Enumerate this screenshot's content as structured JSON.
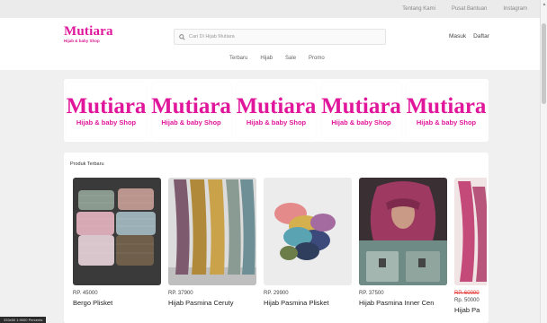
{
  "top_links": [
    "Tentang Kami",
    "Pusat Bantuan",
    "Instagram"
  ],
  "logo": {
    "main": "Mutiara",
    "sub": "Hijab & baby Shop"
  },
  "search": {
    "placeholder": "Cari Di Hijab Mutiara"
  },
  "auth": {
    "login": "Masuk",
    "register": "Daftar"
  },
  "nav": [
    "Terbaru",
    "Hijab",
    "Sale",
    "Promo"
  ],
  "banners": [
    {
      "title": "Mutiara",
      "sub": "Hijab & baby Shop"
    },
    {
      "title": "Mutiara",
      "sub": "Hijab & baby Shop"
    },
    {
      "title": "Mutiara",
      "sub": "Hijab & baby Shop"
    },
    {
      "title": "Mutiara",
      "sub": "Hijab & baby Shop"
    },
    {
      "title": "Mutiara",
      "sub": "Hijab & baby Shop"
    }
  ],
  "section_title": "Produk Terbaru",
  "products": [
    {
      "price": "RP. 45000",
      "name": "Bergo Plisket"
    },
    {
      "price": "RP. 37900",
      "name": "Hijab Pasmina Ceruty"
    },
    {
      "price": "RP. 29900",
      "name": "Hijab Pasmina Plisket"
    },
    {
      "price": "RP. 37500",
      "name": "Hijab Pasmina Inner Cen"
    }
  ],
  "partial_product": {
    "price_old": "RP. 60000",
    "price_new": "Rp. 50000",
    "name": "Hijab Pa"
  },
  "status_text": "333x50 1:9000 Percents",
  "colors": {
    "brand": "#e0179b",
    "sale_price": "#e53935"
  },
  "icons": {
    "search": "search-icon"
  }
}
